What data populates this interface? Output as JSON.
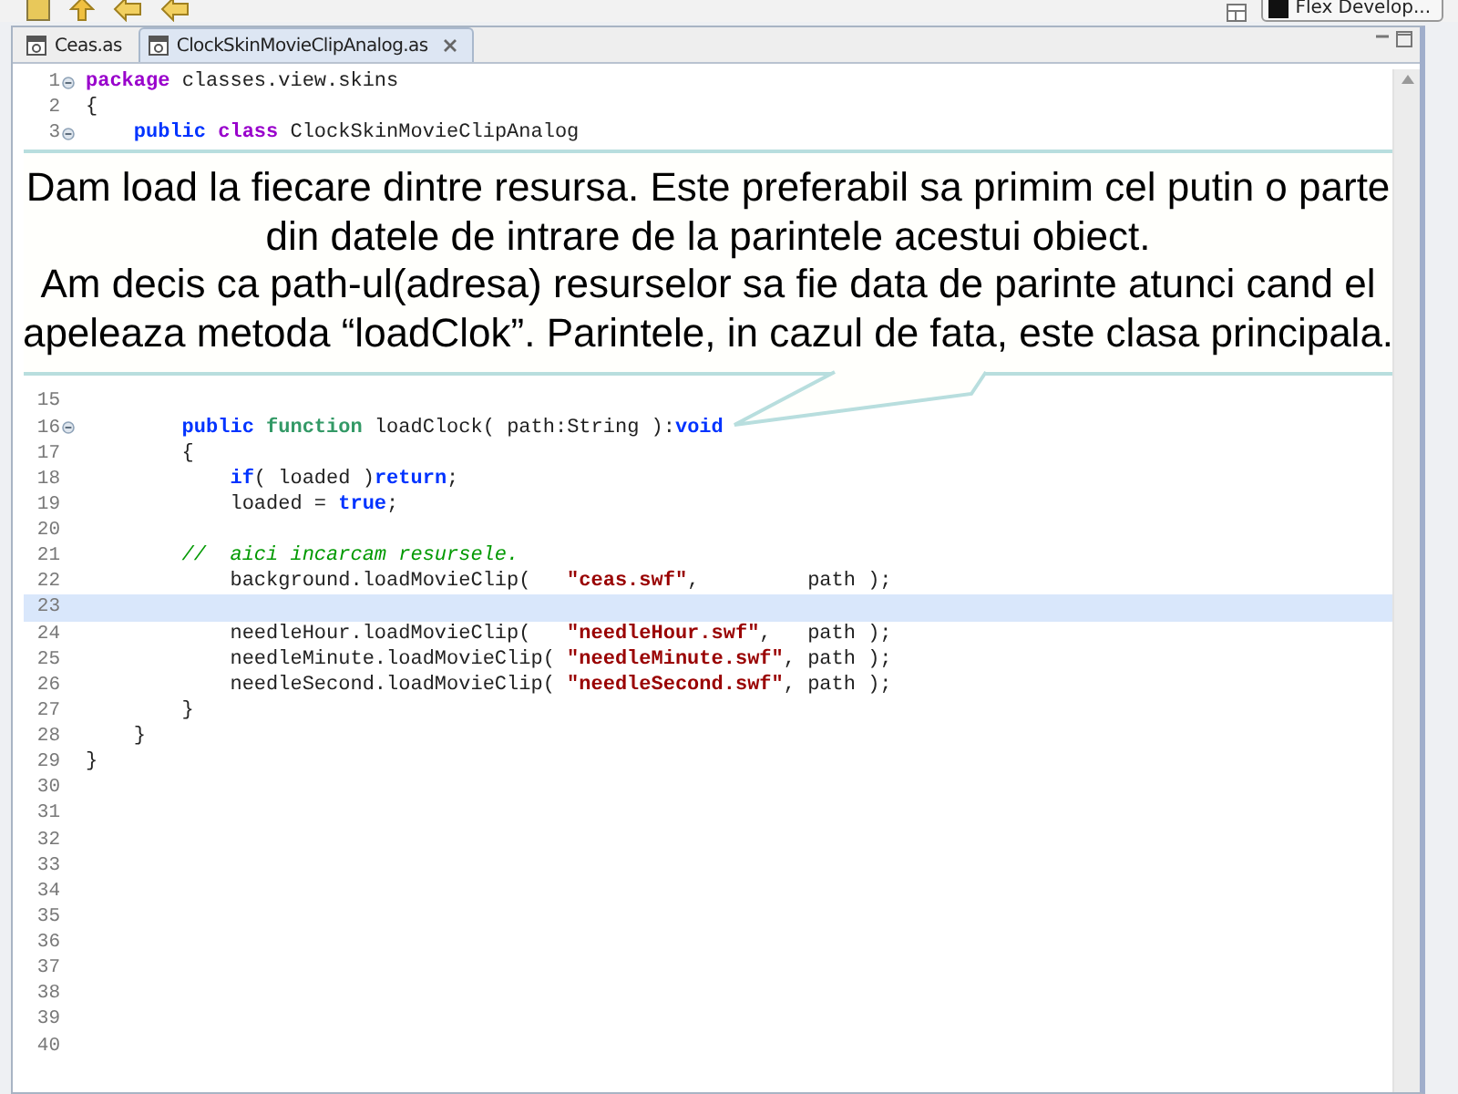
{
  "perspective": {
    "label": "Flex Develop..."
  },
  "tabs": [
    {
      "label": "Ceas.as",
      "selected": false,
      "closable": false
    },
    {
      "label": "ClockSkinMovieClipAnalog.as",
      "selected": true,
      "closable": true
    }
  ],
  "editor": {
    "blocks": [
      {
        "kind": "code",
        "lines": [
          {
            "number": "1",
            "fold": true,
            "highlighted": false,
            "tokens": [
              {
                "kind": "declaration",
                "text": "package "
              },
              {
                "kind": "plain",
                "text": "classes.view.skins"
              }
            ]
          },
          {
            "number": "2",
            "fold": false,
            "highlighted": false,
            "tokens": [
              {
                "kind": "plain",
                "text": "{"
              }
            ]
          },
          {
            "number": "3",
            "fold": true,
            "highlighted": false,
            "tokens": [
              {
                "kind": "keyword",
                "text": "    public "
              },
              {
                "kind": "declaration",
                "text": "class "
              },
              {
                "kind": "plain",
                "text": "ClockSkinMovieClipAnalog"
              }
            ]
          }
        ]
      },
      {
        "kind": "callout",
        "paragraphs": [
          "Dam load la fiecare dintre resursa. Este preferabil sa primim cel putin o parte din datele de intrare de la parintele acestui obiect.",
          "Am decis ca path-ul(adresa) resurselor sa fie data de parinte atunci cand el apeleaza metoda “loadClok”. Parintele, in cazul de fata, este clasa principala."
        ]
      },
      {
        "kind": "code",
        "lines": [
          {
            "number": "15",
            "fold": false,
            "highlighted": false
          },
          {
            "number": "16",
            "fold": true,
            "highlighted": false,
            "tokens": [
              {
                "kind": "keyword",
                "text": "        public "
              },
              {
                "kind": "function",
                "text": "function "
              },
              {
                "kind": "plain",
                "text": "loadClock( path:String ):"
              },
              {
                "kind": "keyword",
                "text": "void"
              }
            ]
          },
          {
            "number": "17",
            "fold": false,
            "highlighted": false,
            "tokens": [
              {
                "kind": "plain",
                "text": "        {"
              }
            ]
          },
          {
            "number": "18",
            "fold": false,
            "highlighted": false,
            "tokens": [
              {
                "kind": "keyword",
                "text": "            if"
              },
              {
                "kind": "plain",
                "text": "( loaded )"
              },
              {
                "kind": "keyword",
                "text": "return"
              },
              {
                "kind": "plain",
                "text": ";"
              }
            ]
          },
          {
            "number": "19",
            "fold": false,
            "highlighted": false,
            "tokens": [
              {
                "kind": "plain",
                "text": "            loaded = "
              },
              {
                "kind": "keyword",
                "text": "true"
              },
              {
                "kind": "plain",
                "text": ";"
              }
            ]
          },
          {
            "number": "20",
            "fold": false,
            "highlighted": false
          },
          {
            "number": "21",
            "fold": false,
            "highlighted": false,
            "tokens": [
              {
                "kind": "comment",
                "text": "        //  aici incarcam resursele."
              }
            ]
          },
          {
            "number": "22",
            "fold": false,
            "highlighted": false,
            "tokens": [
              {
                "kind": "plain",
                "text": "            background.loadMovieClip(   "
              },
              {
                "kind": "string",
                "text": "\"ceas.swf\""
              },
              {
                "kind": "plain",
                "text": ",         path );"
              }
            ]
          },
          {
            "number": "23",
            "fold": false,
            "highlighted": true
          },
          {
            "number": "24",
            "fold": false,
            "highlighted": false,
            "tokens": [
              {
                "kind": "plain",
                "text": "            needleHour.loadMovieClip(   "
              },
              {
                "kind": "string",
                "text": "\"needleHour.swf\""
              },
              {
                "kind": "plain",
                "text": ",   path );"
              }
            ]
          },
          {
            "number": "25",
            "fold": false,
            "highlighted": false,
            "tokens": [
              {
                "kind": "plain",
                "text": "            needleMinute.loadMovieClip( "
              },
              {
                "kind": "string",
                "text": "\"needleMinute.swf\""
              },
              {
                "kind": "plain",
                "text": ", path );"
              }
            ]
          },
          {
            "number": "26",
            "fold": false,
            "highlighted": false,
            "tokens": [
              {
                "kind": "plain",
                "text": "            needleSecond.loadMovieClip( "
              },
              {
                "kind": "string",
                "text": "\"needleSecond.swf\""
              },
              {
                "kind": "plain",
                "text": ", path );"
              }
            ]
          },
          {
            "number": "27",
            "fold": false,
            "highlighted": false,
            "tokens": [
              {
                "kind": "plain",
                "text": "        }"
              }
            ]
          },
          {
            "number": "28",
            "fold": false,
            "highlighted": false,
            "tokens": [
              {
                "kind": "plain",
                "text": "    }"
              }
            ]
          },
          {
            "number": "29",
            "fold": false,
            "highlighted": false,
            "tokens": [
              {
                "kind": "plain",
                "text": "}"
              }
            ]
          },
          {
            "number": "30",
            "fold": false,
            "highlighted": false
          },
          {
            "number": "31",
            "fold": false,
            "highlighted": false
          },
          {
            "number": "32",
            "fold": false,
            "highlighted": false
          },
          {
            "number": "33",
            "fold": false,
            "highlighted": false
          },
          {
            "number": "34",
            "fold": false,
            "highlighted": false
          },
          {
            "number": "35",
            "fold": false,
            "highlighted": false
          },
          {
            "number": "36",
            "fold": false,
            "highlighted": false
          },
          {
            "number": "37",
            "fold": false,
            "highlighted": false
          },
          {
            "number": "38",
            "fold": false,
            "highlighted": false
          },
          {
            "number": "39",
            "fold": false,
            "highlighted": false
          },
          {
            "number": "40",
            "fold": false,
            "highlighted": false
          }
        ]
      }
    ]
  }
}
